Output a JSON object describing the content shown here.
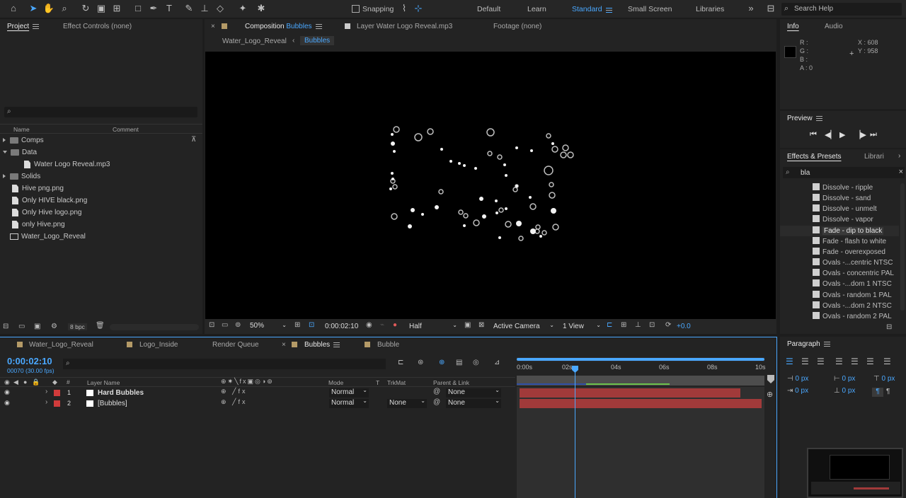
{
  "toolbar": {
    "snapping_label": "Snapping",
    "workspaces": [
      "Default",
      "Learn",
      "Standard",
      "Small Screen",
      "Libraries"
    ],
    "active_workspace": "Standard",
    "search_placeholder": "Search Help"
  },
  "project_panel": {
    "tab_project": "Project",
    "tab_effect_controls": "Effect Controls (none)",
    "col_name": "Name",
    "col_comment": "Comment",
    "items": [
      {
        "label": "Comps",
        "type": "folder",
        "expanded": false
      },
      {
        "label": "Data",
        "type": "folder",
        "expanded": true
      },
      {
        "label": "Water Logo Reveal.mp3",
        "type": "audio",
        "indent": true
      },
      {
        "label": "Solids",
        "type": "folder",
        "expanded": false
      },
      {
        "label": "Hive png.png",
        "type": "image"
      },
      {
        "label": "Only HIVE black.png",
        "type": "image"
      },
      {
        "label": "Only Hive logo.png",
        "type": "image"
      },
      {
        "label": "only Hive.png",
        "type": "image"
      },
      {
        "label": "Water_Logo_Reveal",
        "type": "comp"
      }
    ],
    "bpc": "8 bpc"
  },
  "viewer": {
    "tab_composition_prefix": "Composition",
    "tab_composition_name": "Bubbles",
    "tab_layer": "Layer Water Logo Reveal.mp3",
    "tab_footage": "Footage (none)",
    "breadcrumb_parent": "Water_Logo_Reveal",
    "breadcrumb_current": "Bubbles",
    "zoom": "50%",
    "timecode": "0:00:02:10",
    "resolution": "Half",
    "camera": "Active Camera",
    "views": "1 View",
    "exposure": "+0.0"
  },
  "info_panel": {
    "tab_info": "Info",
    "tab_audio": "Audio",
    "r_label": "R :",
    "g_label": "G :",
    "b_label": "B :",
    "a_label": "A :",
    "a_value": "0",
    "x_readout": "X : 608",
    "y_readout": "Y : 958"
  },
  "preview_panel": {
    "title": "Preview"
  },
  "effects_panel": {
    "tab_effects": "Effects & Presets",
    "tab_libraries": "Librari",
    "search_value": "bla",
    "items": [
      "Dissolve - ripple",
      "Dissolve - sand",
      "Dissolve - unmelt",
      "Dissolve - vapor",
      "Fade - dip to black",
      "Fade - flash to white",
      "Fade - overexposed",
      "Ovals -...centric NTSC",
      "Ovals - concentric PAL",
      "Ovals -...dom 1 NTSC",
      "Ovals - random 1 PAL",
      "Ovals -...dom 2 NTSC",
      "Ovals - random 2 PAL"
    ],
    "selected": "Fade - dip to black"
  },
  "timeline": {
    "tabs": [
      "Water_Logo_Reveal",
      "Logo_Inside",
      "Render Queue",
      "Bubbles",
      "Bubble"
    ],
    "active_tab": "Bubbles",
    "timecode": "0:00:02:10",
    "frame_info": "00070 (30.00 fps)",
    "col_layer_name": "Layer Name",
    "col_mode": "Mode",
    "col_t": "T",
    "col_trkmat": "TrkMat",
    "col_parent": "Parent & Link",
    "ruler": [
      "0:00s",
      "02s",
      "04s",
      "06s",
      "08s",
      "10s"
    ],
    "layers": [
      {
        "num": "1",
        "name": "Hard Bubbles",
        "mode": "Normal",
        "trkmat": "",
        "parent": "None"
      },
      {
        "num": "2",
        "name": "[Bubbles]",
        "mode": "Normal",
        "trkmat": "None",
        "parent": "None"
      }
    ]
  },
  "paragraph_panel": {
    "title": "Paragraph",
    "indent_values": [
      "0 px",
      "0 px",
      "0 px",
      "0 px",
      "0 px"
    ]
  },
  "colors": {
    "accent": "#4aa8ff",
    "layer_bar": "#a13a3a",
    "label_red": "#d03b3b",
    "panel_bg": "#232323"
  }
}
